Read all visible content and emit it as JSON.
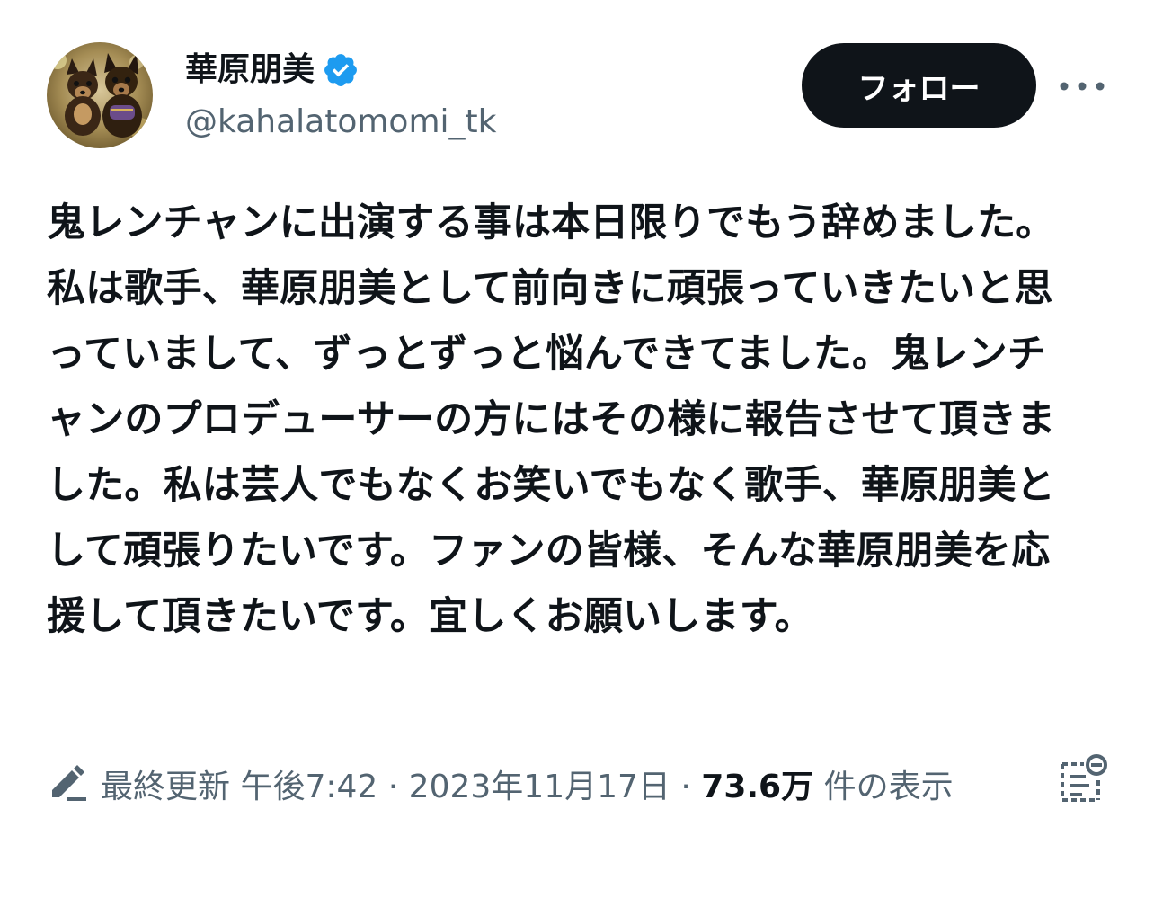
{
  "author": {
    "display_name": "華原朋美",
    "handle": "@kahalatomomi_tk",
    "verified": true,
    "avatar_icon": "avatar-two-dogs-photo"
  },
  "actions": {
    "follow_label": "フォロー",
    "more_icon": "more-horizontal-icon"
  },
  "tweet": {
    "text": "鬼レンチャンに出演する事は本日限りでもう辞めました。私は歌手、華原朋美として前向きに頑張っていきたいと思っていまして、ずっとずっと悩んできてました。鬼レンチャンのプロデューサーの方にはその様に報告させて頂きました。私は芸人でもなくお笑いでもなく歌手、華原朋美として頑張りたいです。ファンの皆様、そんな華原朋美を応援して頂きたいです。宜しくお願いします。"
  },
  "meta": {
    "edited_label": "最終更新",
    "time": "午後7:42",
    "separator": "·",
    "date": "2023年11月17日",
    "views_count": "73.6万",
    "views_suffix": "件の表示",
    "analytics_icon": "analytics-icon"
  },
  "colors": {
    "primary_text": "#0f1419",
    "secondary_text": "#536471",
    "verified_blue": "#1d9bf0",
    "follow_bg": "#0f1419",
    "follow_text": "#ffffff"
  }
}
